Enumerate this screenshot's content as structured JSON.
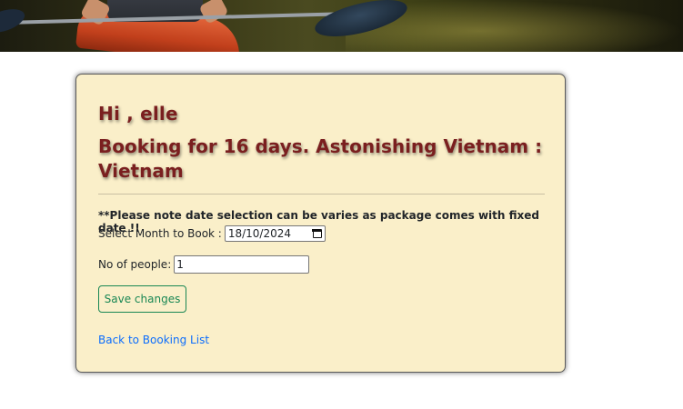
{
  "banner": {
    "image": "kayak-paddler-on-river-photo"
  },
  "booking": {
    "greeting": "Hi , elle",
    "title": "Booking for 16 days. Astonishing Vietnam : Vietnam",
    "note": "**Please note date selection can be varies as package comes with fixed date !!",
    "month_label": "Select Month to Book :",
    "month_value": "18/10/2024",
    "people_label": "No of people:",
    "people_value": "1",
    "save_label": "Save changes",
    "back_link_label": "Back to Booking List"
  },
  "colors": {
    "card_background": "#faefc9",
    "heading": "#7a1f1f",
    "save_button": "#198754",
    "link": "#0d6efd"
  }
}
